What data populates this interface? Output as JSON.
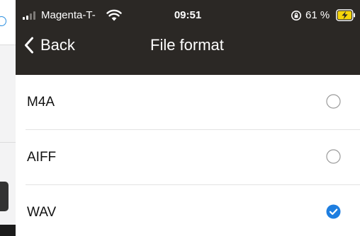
{
  "status_bar": {
    "carrier": "Magenta-T-",
    "time": "09:51",
    "battery": "61 %"
  },
  "nav": {
    "back_label": "Back",
    "title": "File format"
  },
  "options": [
    {
      "label": "M4A",
      "selected": false
    },
    {
      "label": "AIFF",
      "selected": false
    },
    {
      "label": "WAV",
      "selected": true
    }
  ],
  "colors": {
    "header_bg": "#2b2825",
    "accent": "#1e7ee0",
    "battery_fill": "#f5d50a"
  },
  "icons": {
    "signal": "cellular-signal-icon",
    "wifi": "wifi-icon",
    "orientation_lock": "orientation-lock-icon",
    "battery": "battery-charging-icon",
    "back": "chevron-left-icon",
    "radio_off": "radio-unchecked-icon",
    "radio_on": "radio-checked-icon"
  }
}
